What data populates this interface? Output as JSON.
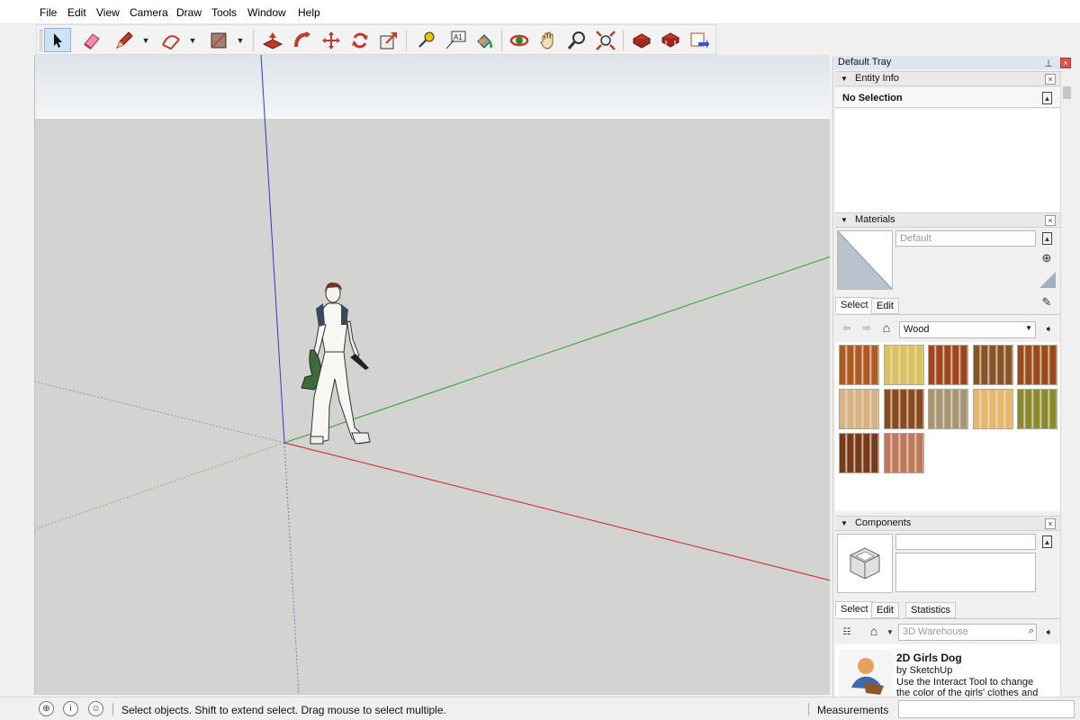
{
  "menu": [
    "File",
    "Edit",
    "View",
    "Camera",
    "Draw",
    "Tools",
    "Window",
    "Help"
  ],
  "toolbar": {
    "tools": [
      "select-tool",
      "eraser-tool",
      "line-tool",
      "arc-tool",
      "shape-tool",
      "push-pull-tool",
      "offset-tool",
      "move-tool",
      "rotate-tool",
      "scale-tool",
      "tape-measure-tool",
      "text-tool",
      "paint-bucket-tool",
      "orbit-tool",
      "pan-tool",
      "zoom-tool",
      "zoom-extents-tool",
      "warehouse-tool",
      "extension-warehouse-tool",
      "send-to-layout-tool"
    ],
    "text_tool_label": "A1"
  },
  "tray": {
    "title": "Default Tray",
    "entity_info": {
      "title": "Entity Info",
      "selection": "No Selection"
    },
    "materials": {
      "title": "Materials",
      "name_placeholder": "Default",
      "tabs": [
        "Select",
        "Edit"
      ],
      "library": "Wood",
      "swatch_colors": [
        "#b05a22",
        "#dcc25a",
        "#a2441a",
        "#8a5324",
        "#9c4a18",
        "#d8b380",
        "#8b4a1c",
        "#a89670",
        "#e8b868",
        "#8a8a2a",
        "#7a3a18",
        "#c07858"
      ]
    },
    "components": {
      "title": "Components",
      "tabs": [
        "Select",
        "Edit",
        "Statistics"
      ],
      "search_placeholder": "3D Warehouse",
      "item": {
        "title": "2D Girls Dog",
        "author": "by SketchUp",
        "description": "Use the Interact Tool to change the color of the girls' clothes and the d..."
      }
    }
  },
  "status": {
    "message": "Select objects. Shift to extend select. Drag mouse to select multiple.",
    "measurements_label": "Measurements",
    "measurements_value": ""
  },
  "colors": {
    "viewport_ground": "#d3d3d2",
    "sky": "#eef1f4",
    "axis_red": "#cc2222",
    "axis_green": "#2aa02a",
    "axis_blue": "#2222bb",
    "accent": "#cfe3f7"
  }
}
